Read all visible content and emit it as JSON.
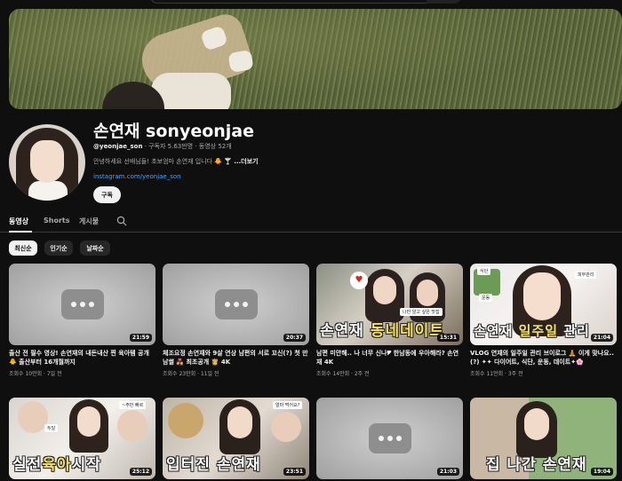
{
  "channel": {
    "name": "손연재 sonyeonjae",
    "handle": "@yeonjae_son",
    "stats": " · 구독자 5.63만명 · 동영상 52개",
    "description": "안녕하세요 선배님들! 초보엄마 손연재 입니다 🐥 🍸 ",
    "more_label": "...더보기",
    "link": "instagram.com/yeonjae_son",
    "subscribe_label": "구독"
  },
  "tabs": [
    {
      "label": "동영상",
      "active": true
    },
    {
      "label": "Shorts",
      "active": false
    },
    {
      "label": "게시물",
      "active": false
    }
  ],
  "chips": [
    {
      "label": "최신순",
      "selected": true
    },
    {
      "label": "인기순",
      "selected": false
    },
    {
      "label": "날짜순",
      "selected": false
    }
  ],
  "videos": [
    {
      "title": "출산 전 필수 영상! 손연재의 내돈내산 찐 육아템 공개 🐥 출산부터 16개월까지",
      "meta": "조회수 10만회 · 7일 전",
      "duration": "21:59",
      "thumb": "placeholder"
    },
    {
      "title": "체조요정 손연재와 9살 연상 남편의 서로 꼬신(?) 첫 만남썰 👩‍❤️‍👨 최초공개 👸 4K",
      "meta": "조회수 23만회 · 11일 전",
      "duration": "20:37",
      "thumb": "placeholder"
    },
    {
      "title": "남편 미안해.. 나 너무 신나🎔 한남동에 우아해라? 손연재 4K",
      "meta": "조회수 14만회 · 2주 전",
      "duration": "15:31",
      "thumb": "photo",
      "caption_a": "손연재 ",
      "caption_b": "동네데이트"
    },
    {
      "title": "VLOG 연재의 일주일 관리 브이로그 🧘 이게 맞나요..(?) ✦✦ 다이어트, 식단, 운동, 데이트✦🌸",
      "meta": "조회수 11만회 · 3주 전",
      "duration": "21:04",
      "thumb": "photo",
      "caption_a": "손연재 ",
      "caption_b": "일주일",
      "caption_c": " 관리"
    },
    {
      "duration": "25:12",
      "thumb": "photo",
      "caption_a": "실전",
      "caption_b": "육아",
      "caption_c": "시작"
    },
    {
      "duration": "23:51",
      "thumb": "photo",
      "caption_a": "입터진 손연재"
    },
    {
      "duration": "21:03",
      "thumb": "placeholder"
    },
    {
      "duration": "19:04",
      "thumb": "photo",
      "caption_a": "집 나간 손연재"
    }
  ],
  "thumb_tags": {
    "v3_tag1": "나만 알고 싶은 맛집",
    "v4_tag1": "피부관리",
    "v4_tag2": "식단",
    "v4_tag3": "운동",
    "v5_tag1": "~주만 빠르",
    "v5_tag2": "두달",
    "v6_tag1": "얼마 먹어요?"
  }
}
